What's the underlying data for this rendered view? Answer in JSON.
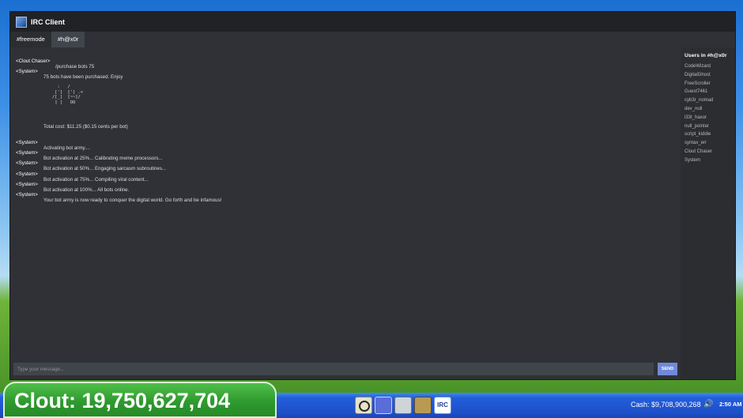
{
  "window": {
    "title": "IRC Client"
  },
  "tabs": [
    {
      "label": "#freemode",
      "active": false
    },
    {
      "label": "#h@x0r",
      "active": true
    }
  ],
  "messages": [
    {
      "nick": "<Clout Chaser>",
      "text": "/purchase bots 75"
    },
    {
      "nick": "<System>",
      "text": "75 bots have been purchased. Enjoy"
    }
  ],
  "ascii_art": "  :   /\n [']  ['] .<\n/[_]  [~~]/\n ] [   OO",
  "cost_line": "Total cost: $11.25 ($0.15 cents per bot)",
  "activation_messages": [
    {
      "nick": "<System>",
      "text": "Activating bot army...."
    },
    {
      "nick": "<System>",
      "text": "Bot activation at 25%... Calibrating meme processors..."
    },
    {
      "nick": "<System>",
      "text": "Bot activation at 50%... Engaging sarcasm subroutines..."
    },
    {
      "nick": "<System>",
      "text": "Bot activation at 75%... Compiling viral content..."
    },
    {
      "nick": "<System>",
      "text": "Bot activation at 100%... All bots online."
    },
    {
      "nick": "<System>",
      "text": "Your bot army is now ready to conquer the digital world. Go forth and be infamous!"
    }
  ],
  "userlist": {
    "title": "Users in #h@x0r",
    "users": [
      "CodeWizard",
      "DigitalGhost",
      "FreeScroller",
      "Guest7461",
      "cyb3r_nomad",
      "dev_null",
      "l33t_haxor",
      "null_pointer",
      "script_kiddie",
      "syntax_err",
      "Clout Chaser",
      "System"
    ]
  },
  "input": {
    "placeholder": "Type your message...",
    "send_label": "SEND"
  },
  "taskbar": {
    "clout_text": "Clout: 19,750,627,704",
    "icon5_label": "IRC",
    "cash_text": "Cash: $9,708,900,268",
    "volume_icon": "🔊",
    "clock": "2:50 AM"
  },
  "colors": {
    "send_button": "#7289da",
    "clout_badge": "#2f9a2f",
    "taskbar": "#245edb"
  }
}
